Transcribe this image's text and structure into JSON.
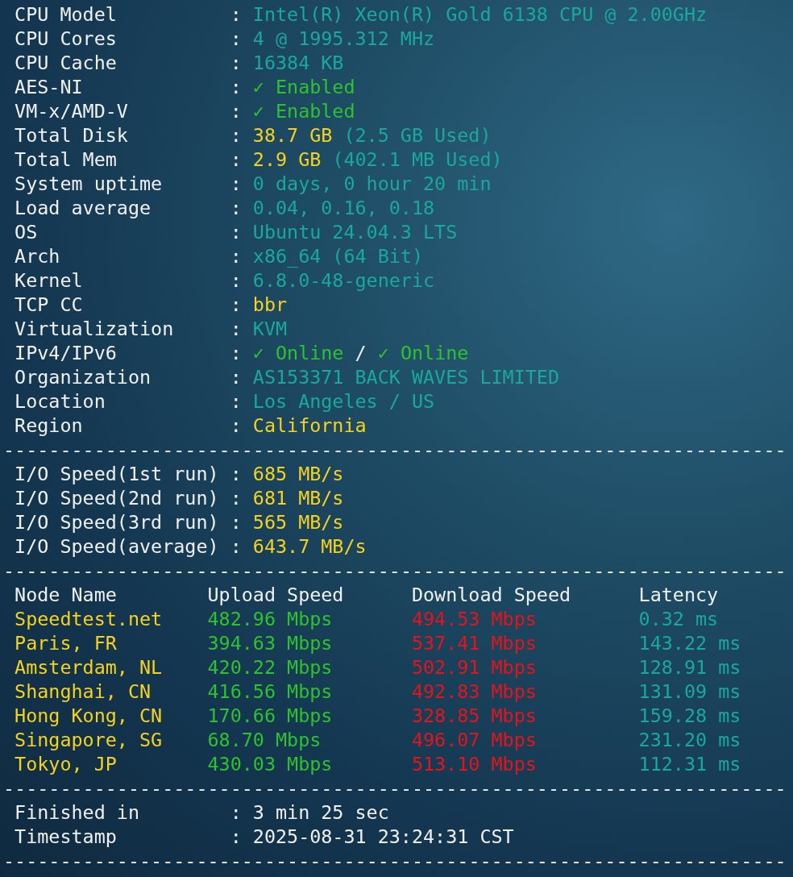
{
  "info": [
    {
      "label": "CPU Model",
      "colon": ":",
      "value": [
        {
          "text": "Intel(R) Xeon(R) Gold 6138 CPU @ 2.00GHz",
          "color": "#1aa89c"
        }
      ]
    },
    {
      "label": "CPU Cores",
      "colon": ":",
      "value": [
        {
          "text": "4 @ 1995.312 MHz",
          "color": "#1aa89c"
        }
      ]
    },
    {
      "label": "CPU Cache",
      "colon": ":",
      "value": [
        {
          "text": "16384 KB",
          "color": "#1aa89c"
        }
      ]
    },
    {
      "label": "AES-NI",
      "colon": ":",
      "value": [
        {
          "text": "✓ Enabled",
          "color": "#2ec22e"
        }
      ]
    },
    {
      "label": "VM-x/AMD-V",
      "colon": ":",
      "value": [
        {
          "text": "✓ Enabled",
          "color": "#2ec22e"
        }
      ]
    },
    {
      "label": "Total Disk",
      "colon": ":",
      "value": [
        {
          "text": "38.7 GB",
          "color": "#f5d21e"
        },
        {
          "text": "(2.5 GB Used)",
          "color": "#1aa89c"
        }
      ]
    },
    {
      "label": "Total Mem",
      "colon": ":",
      "value": [
        {
          "text": "2.9 GB",
          "color": "#f5d21e"
        },
        {
          "text": "(402.1 MB Used)",
          "color": "#1aa89c"
        }
      ]
    },
    {
      "label": "System uptime",
      "colon": ":",
      "value": [
        {
          "text": "0 days, 0 hour 20 min",
          "color": "#1aa89c"
        }
      ]
    },
    {
      "label": "Load average",
      "colon": ":",
      "value": [
        {
          "text": "0.04, 0.16, 0.18",
          "color": "#1aa89c"
        }
      ]
    },
    {
      "label": "OS",
      "colon": ":",
      "value": [
        {
          "text": "Ubuntu 24.04.3 LTS",
          "color": "#1aa89c"
        }
      ]
    },
    {
      "label": "Arch",
      "colon": ":",
      "value": [
        {
          "text": "x86_64 (64 Bit)",
          "color": "#1aa89c"
        }
      ]
    },
    {
      "label": "Kernel",
      "colon": ":",
      "value": [
        {
          "text": "6.8.0-48-generic",
          "color": "#1aa89c"
        }
      ]
    },
    {
      "label": "TCP CC",
      "colon": ":",
      "value": [
        {
          "text": "bbr",
          "color": "#f5d21e"
        }
      ]
    },
    {
      "label": "Virtualization",
      "colon": ":",
      "value": [
        {
          "text": "KVM",
          "color": "#1aa89c"
        }
      ]
    },
    {
      "label": "IPv4/IPv6",
      "colon": ":",
      "value": [
        {
          "text": "✓ Online",
          "color": "#2ec22e"
        },
        {
          "text": "/",
          "color": "#f0f0f0"
        },
        {
          "text": "✓ Online",
          "color": "#2ec22e"
        }
      ]
    },
    {
      "label": "Organization",
      "colon": ":",
      "value": [
        {
          "text": "AS153371 BACK WAVES LIMITED",
          "color": "#1aa89c"
        }
      ]
    },
    {
      "label": "Location",
      "colon": ":",
      "value": [
        {
          "text": "Los Angeles / US",
          "color": "#1aa89c"
        }
      ]
    },
    {
      "label": "Region",
      "colon": ":",
      "value": [
        {
          "text": "California",
          "color": "#f5d21e"
        }
      ]
    }
  ],
  "separator_1": "---------------------------------------------------------------------",
  "io": [
    {
      "label": "I/O Speed(1st run)",
      "colon": ":",
      "value": [
        {
          "text": "685 MB/s",
          "color": "#f5d21e"
        }
      ]
    },
    {
      "label": "I/O Speed(2nd run)",
      "colon": ":",
      "value": [
        {
          "text": "681 MB/s",
          "color": "#f5d21e"
        }
      ]
    },
    {
      "label": "I/O Speed(3rd run)",
      "colon": ":",
      "value": [
        {
          "text": "565 MB/s",
          "color": "#f5d21e"
        }
      ]
    },
    {
      "label": "I/O Speed(average)",
      "colon": ":",
      "value": [
        {
          "text": "643.7 MB/s",
          "color": "#f5d21e"
        }
      ]
    }
  ],
  "separator_2": "---------------------------------------------------------------------",
  "speedtest": {
    "columns": [
      "Node Name",
      "Upload Speed",
      "Download Speed",
      "Latency"
    ],
    "rows": [
      {
        "node": "Speedtest.net",
        "upload": "482.96 Mbps",
        "download": "494.53 Mbps",
        "latency": "0.32 ms"
      },
      {
        "node": "Paris, FR",
        "upload": "394.63 Mbps",
        "download": "537.41 Mbps",
        "latency": "143.22 ms"
      },
      {
        "node": "Amsterdam, NL",
        "upload": "420.22 Mbps",
        "download": "502.91 Mbps",
        "latency": "128.91 ms"
      },
      {
        "node": "Shanghai, CN",
        "upload": "416.56 Mbps",
        "download": "492.83 Mbps",
        "latency": "131.09 ms"
      },
      {
        "node": "Hong Kong, CN",
        "upload": "170.66 Mbps",
        "download": "328.85 Mbps",
        "latency": "159.28 ms"
      },
      {
        "node": "Singapore, SG",
        "upload": "68.70 Mbps",
        "download": "496.07 Mbps",
        "latency": "231.20 ms"
      },
      {
        "node": "Tokyo, JP",
        "upload": "430.03 Mbps",
        "download": "513.10 Mbps",
        "latency": "112.31 ms"
      }
    ]
  },
  "separator_3": "---------------------------------------------------------------------",
  "summary": [
    {
      "label": "Finished in",
      "colon": ":",
      "value": [
        {
          "text": "3 min 25 sec",
          "color": "#f0f0f0"
        }
      ]
    },
    {
      "label": "Timestamp",
      "colon": ":",
      "value": [
        {
          "text": "2025-08-31 23:24:31 CST",
          "color": "#f0f0f0"
        }
      ]
    }
  ],
  "separator_4": "---------------------------------------------------------------------"
}
